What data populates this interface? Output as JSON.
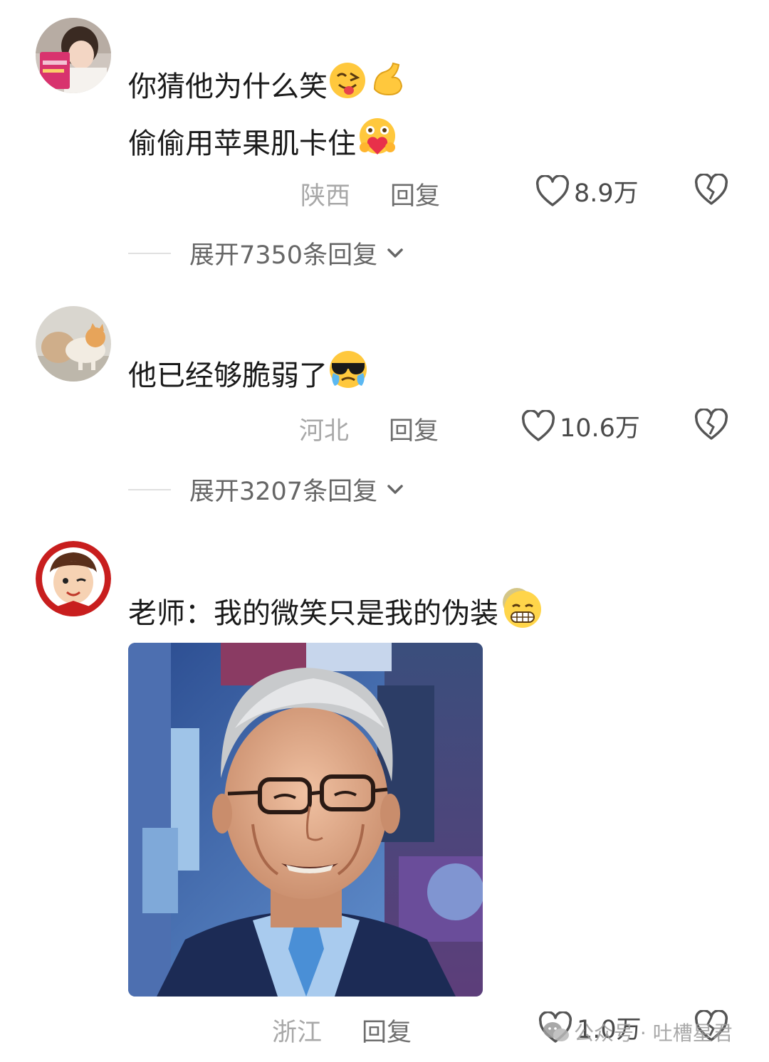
{
  "comments": [
    {
      "lines": [
        "你猜他为什么笑",
        "偷偷用苹果肌卡住"
      ],
      "region": "陕西",
      "reply_label": "回复",
      "likes": "8.9万",
      "expand_label": "展开7350条回复"
    },
    {
      "lines": [
        "他已经够脆弱了"
      ],
      "region": "河北",
      "reply_label": "回复",
      "likes": "10.6万",
      "expand_label": "展开3207条回复"
    },
    {
      "lines": [
        "老师：我的微笑只是我的伪装"
      ],
      "region": "浙江",
      "reply_label": "回复",
      "likes": "1.0万"
    }
  ],
  "watermark": "公众号 · 吐槽星君",
  "colors": {
    "text": "#1a1a1a",
    "meta": "#8a8a8a",
    "heart": "#555555"
  }
}
